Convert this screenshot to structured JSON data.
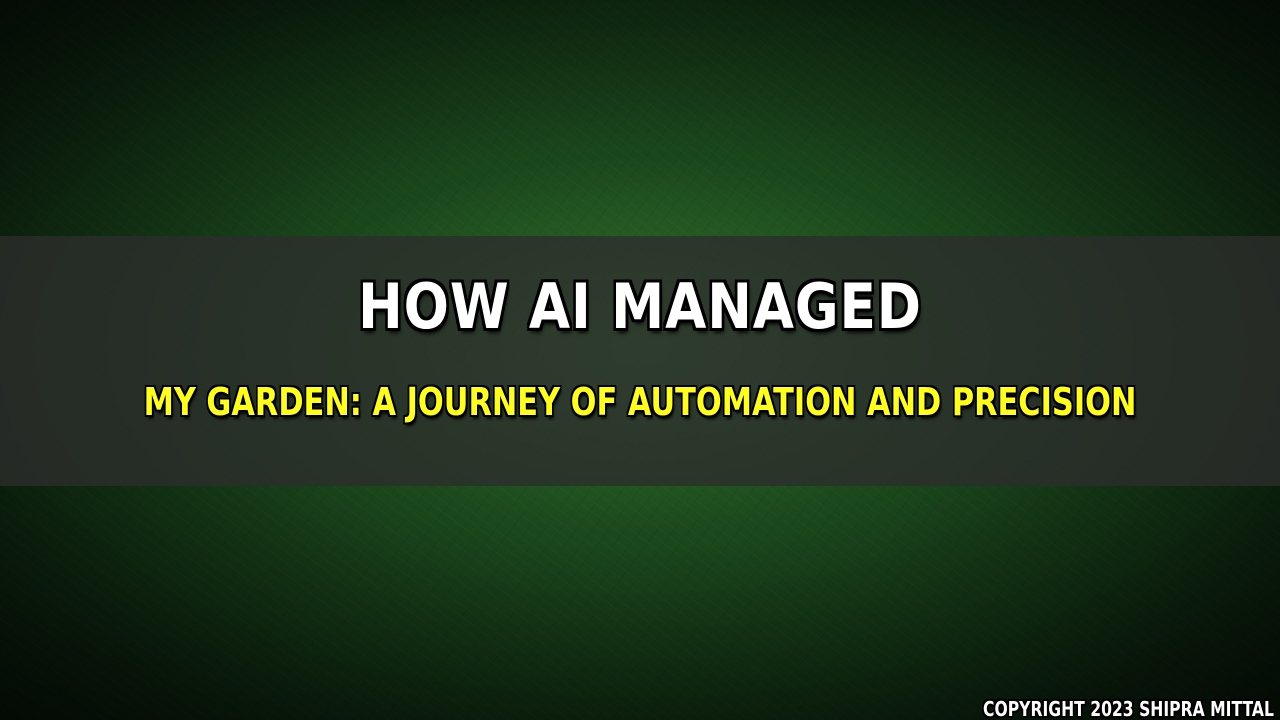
{
  "title": "HOW AI MANAGED",
  "subtitle": "MY GARDEN: A JOURNEY OF AUTOMATION AND PRECISION",
  "copyright": "COPYRIGHT 2023 SHIPRA MITTAL",
  "colors": {
    "background": "#1d4a1f",
    "band": "#2d2d2d",
    "title": "#ffffff",
    "subtitle": "#ffff1a"
  }
}
